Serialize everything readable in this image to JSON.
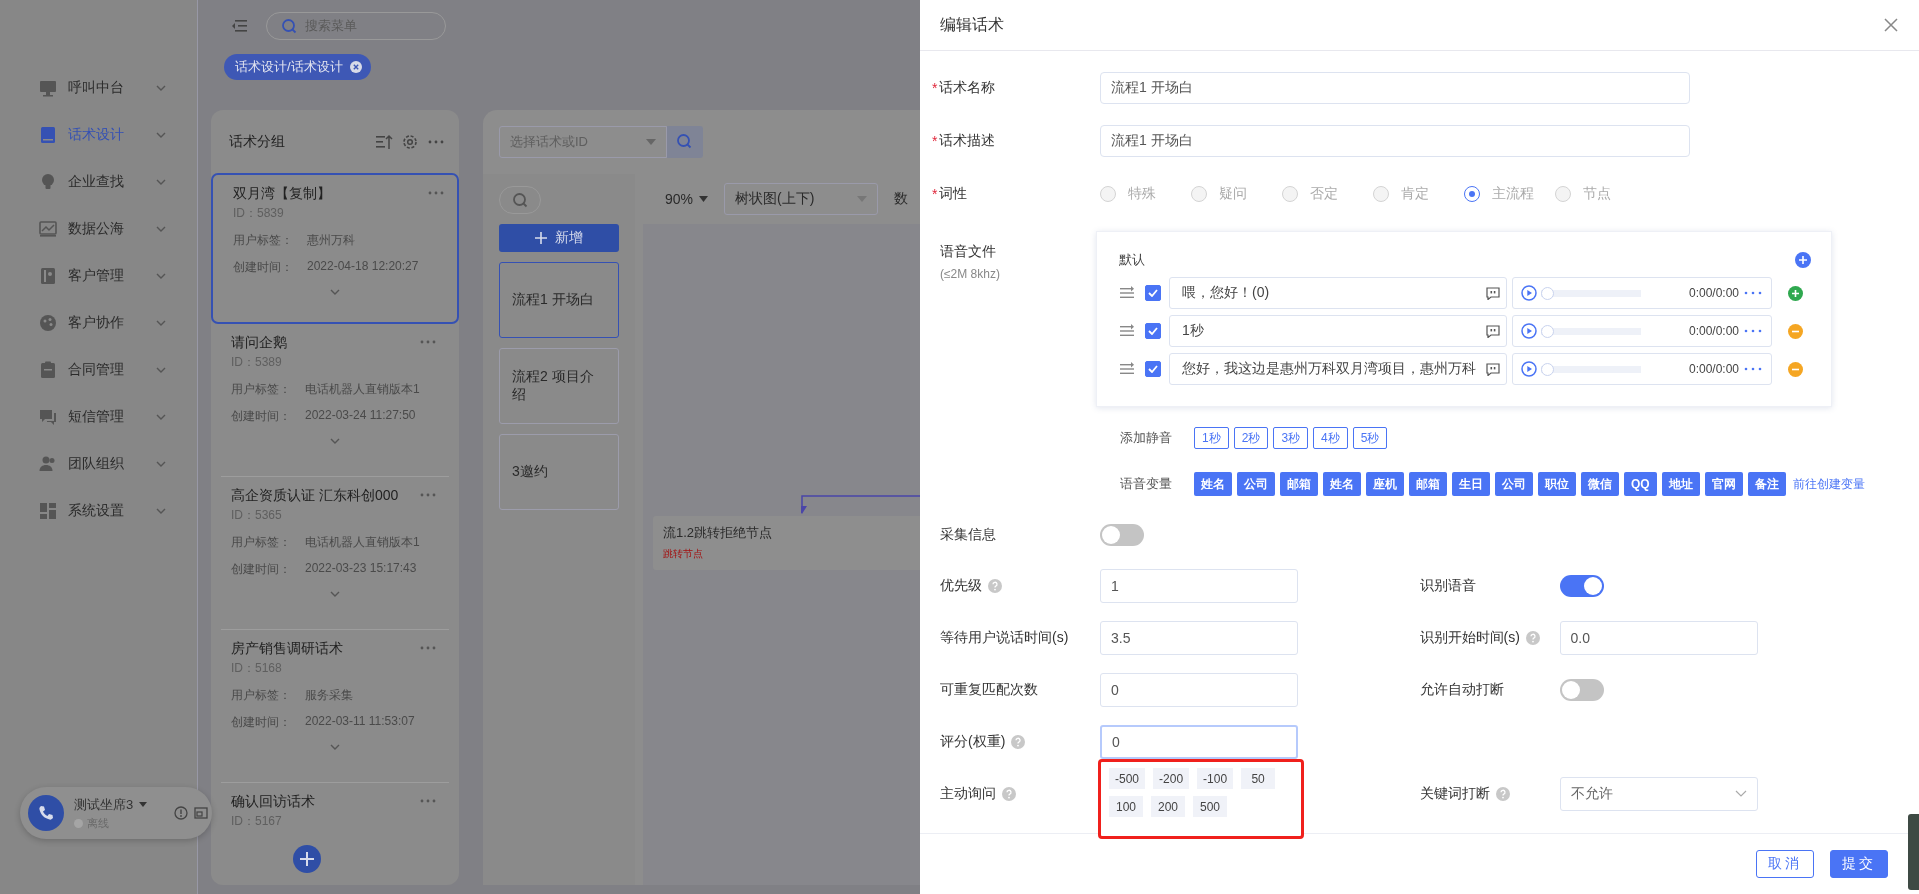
{
  "topbar": {
    "menu_search": {
      "placeholder": "搜索菜单"
    }
  },
  "breadcrumb": {
    "label": "话术设计/话术设计"
  },
  "sidebar": {
    "items": [
      {
        "label": "呼叫中台",
        "selected": false
      },
      {
        "label": "话术设计",
        "selected": true
      },
      {
        "label": "企业查找",
        "selected": false
      },
      {
        "label": "数据公海",
        "selected": false
      },
      {
        "label": "客户管理",
        "selected": false
      },
      {
        "label": "客户协作",
        "selected": false
      },
      {
        "label": "合同管理",
        "selected": false
      },
      {
        "label": "短信管理",
        "selected": false
      },
      {
        "label": "团队组织",
        "selected": false
      },
      {
        "label": "系统设置",
        "selected": false
      }
    ]
  },
  "script_groups": {
    "title": "话术分组",
    "cards": [
      {
        "name": "双月湾【复制】",
        "id": "ID：5839",
        "tag_label": "用户标签：",
        "tag": "惠州万科",
        "created_label": "创建时间：",
        "created": "2022-04-18 12:20:27",
        "selected": true
      },
      {
        "name": "请问企鹅",
        "id": "ID：5389",
        "tag_label": "用户标签：",
        "tag": "电话机器人直销版本1",
        "created_label": "创建时间：",
        "created": "2022-03-24 11:27:50",
        "selected": false
      },
      {
        "name": "高企资质认证 汇东科创000",
        "id": "ID：5365",
        "tag_label": "用户标签：",
        "tag": "电话机器人直销版本1",
        "created_label": "创建时间：",
        "created": "2022-03-23 15:17:43",
        "selected": false
      },
      {
        "name": "房产销售调研话术",
        "id": "ID：5168",
        "tag_label": "用户标签：",
        "tag": "服务采集",
        "created_label": "创建时间：",
        "created": "2022-03-11 11:53:07",
        "selected": false
      },
      {
        "name": "确认回访话术",
        "id": "ID：5167",
        "selected": false
      }
    ]
  },
  "call_widget": {
    "seat": "测试坐席3",
    "status": "离线"
  },
  "flow_panel": {
    "script_select": {
      "placeholder": "选择话术或ID"
    },
    "new_button": "新增",
    "flows": [
      {
        "label": "流程1 开场白",
        "selected": true
      },
      {
        "label": "流程2 项目介绍",
        "selected": false
      },
      {
        "label": "3邀约",
        "selected": false
      }
    ],
    "zoom": "90%",
    "layout_select": "树状图(上下)",
    "toolbar_text": "数",
    "nodes": [
      {
        "title": "流1.2跳转拒绝节点",
        "subtitle": "跳转节点"
      }
    ]
  },
  "drawer": {
    "title": "编辑话术",
    "fields": [
      {
        "label": "话术名称",
        "required_mark": "*",
        "value": "流程1 开场白"
      },
      {
        "label": "话术描述",
        "required_mark": "*",
        "value": "流程1 开场白"
      }
    ],
    "part_of_speech": {
      "label": "词性",
      "required_mark": "*",
      "options": [
        {
          "label": "特殊",
          "selected": false
        },
        {
          "label": "疑问",
          "selected": false
        },
        {
          "label": "否定",
          "selected": false
        },
        {
          "label": "肯定",
          "selected": false
        },
        {
          "label": "主流程",
          "selected": true
        },
        {
          "label": "节点",
          "selected": false
        }
      ]
    },
    "voice_files": {
      "label": "语音文件",
      "hint": "(≤2M 8khz)",
      "group": "默认",
      "rows": [
        {
          "checked": true,
          "text": "喂，您好！(0)",
          "time": "0:00/0:00",
          "level": 0,
          "kind": "add"
        },
        {
          "checked": true,
          "text": "1秒",
          "time": "0:00/0:00",
          "level": 0,
          "kind": "remove"
        },
        {
          "checked": true,
          "text": "您好，我这边是惠州万科双月湾项目，惠州万科",
          "time": "0:00/0:00",
          "level": 0,
          "kind": "remove"
        }
      ]
    },
    "silence": {
      "label": "添加静音",
      "buttons": [
        "1秒",
        "2秒",
        "3秒",
        "4秒",
        "5秒"
      ]
    },
    "variables": {
      "label": "语音变量",
      "tags": [
        "姓名",
        "公司",
        "邮箱",
        "姓名",
        "座机",
        "邮箱",
        "生日",
        "公司",
        "职位",
        "微信",
        "QQ",
        "地址",
        "官网",
        "备注"
      ],
      "link": "前往创建变量"
    },
    "collect_info": {
      "label": "采集信息",
      "on": false
    },
    "settings": [
      {
        "left": {
          "kind": "input",
          "label": "优先级",
          "help": true,
          "value": "1"
        },
        "right": {
          "kind": "switch",
          "label": "识别语音",
          "help": false,
          "on": true
        }
      },
      {
        "left": {
          "kind": "input",
          "label": "等待用户说话时间(s)",
          "help": false,
          "value": "3.5"
        },
        "right": {
          "kind": "input",
          "label": "识别开始时间(s)",
          "help": true,
          "value": "0.0"
        }
      },
      {
        "left": {
          "kind": "input",
          "label": "可重复匹配次数",
          "help": false,
          "value": "0"
        },
        "right": {
          "kind": "switch",
          "label": "允许自动打断",
          "help": false,
          "on": false
        }
      },
      {
        "left": {
          "kind": "input",
          "label": "评分(权重)",
          "help": true,
          "value": "0",
          "focused": true
        }
      },
      {
        "left": {
          "kind": "options",
          "label": "主动询问",
          "help": true,
          "highlighted": true,
          "options": [
            "-500",
            "-200",
            "-100",
            "50",
            "100",
            "200",
            "500"
          ]
        },
        "right": {
          "kind": "select",
          "label": "关键词打断",
          "help": true,
          "value": "不允许"
        }
      }
    ],
    "buttons": [
      {
        "label": "取消",
        "kind": "secondary"
      },
      {
        "label": "提交",
        "kind": "primary"
      }
    ]
  }
}
